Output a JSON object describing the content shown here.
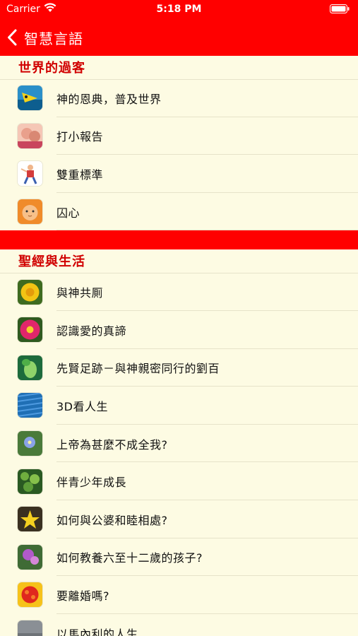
{
  "status_bar": {
    "carrier": "Carrier",
    "time": "5:18 PM"
  },
  "nav": {
    "back_label": "智慧言語",
    "accent_color": "#ff0000"
  },
  "sections": [
    {
      "title": "世界的過客",
      "items": [
        {
          "label": "神的恩典，普及世界",
          "icon": "bird-thumbnail"
        },
        {
          "label": "打小報告",
          "icon": "children-thumbnail"
        },
        {
          "label": "雙重標準",
          "icon": "cartoon-person-thumbnail"
        },
        {
          "label": "囚心",
          "icon": "cat-thumbnail"
        }
      ]
    },
    {
      "title": "聖經與生活",
      "items": [
        {
          "label": "與神共厠",
          "icon": "yellow-flower-thumbnail"
        },
        {
          "label": "認識愛的真諦",
          "icon": "pink-flower-thumbnail"
        },
        {
          "label": "先賢足跡－與神親密同行的劉百",
          "icon": "green-plant-thumbnail"
        },
        {
          "label": "3D看人生",
          "icon": "blue-pattern-thumbnail"
        },
        {
          "label": "上帝為甚麼不成全我?",
          "icon": "blue-flower-thumbnail"
        },
        {
          "label": "伴青少年成長",
          "icon": "green-leaves-thumbnail"
        },
        {
          "label": "如何與公婆和睦相處?",
          "icon": "yellow-star-flower-thumbnail"
        },
        {
          "label": "如何教養六至十二歲的孩子?",
          "icon": "purple-flower-thumbnail"
        },
        {
          "label": "要離婚嗎?",
          "icon": "red-flower-thumbnail"
        },
        {
          "label": "以馬內利的人生",
          "icon": "grey-stone-thumbnail"
        }
      ]
    }
  ]
}
